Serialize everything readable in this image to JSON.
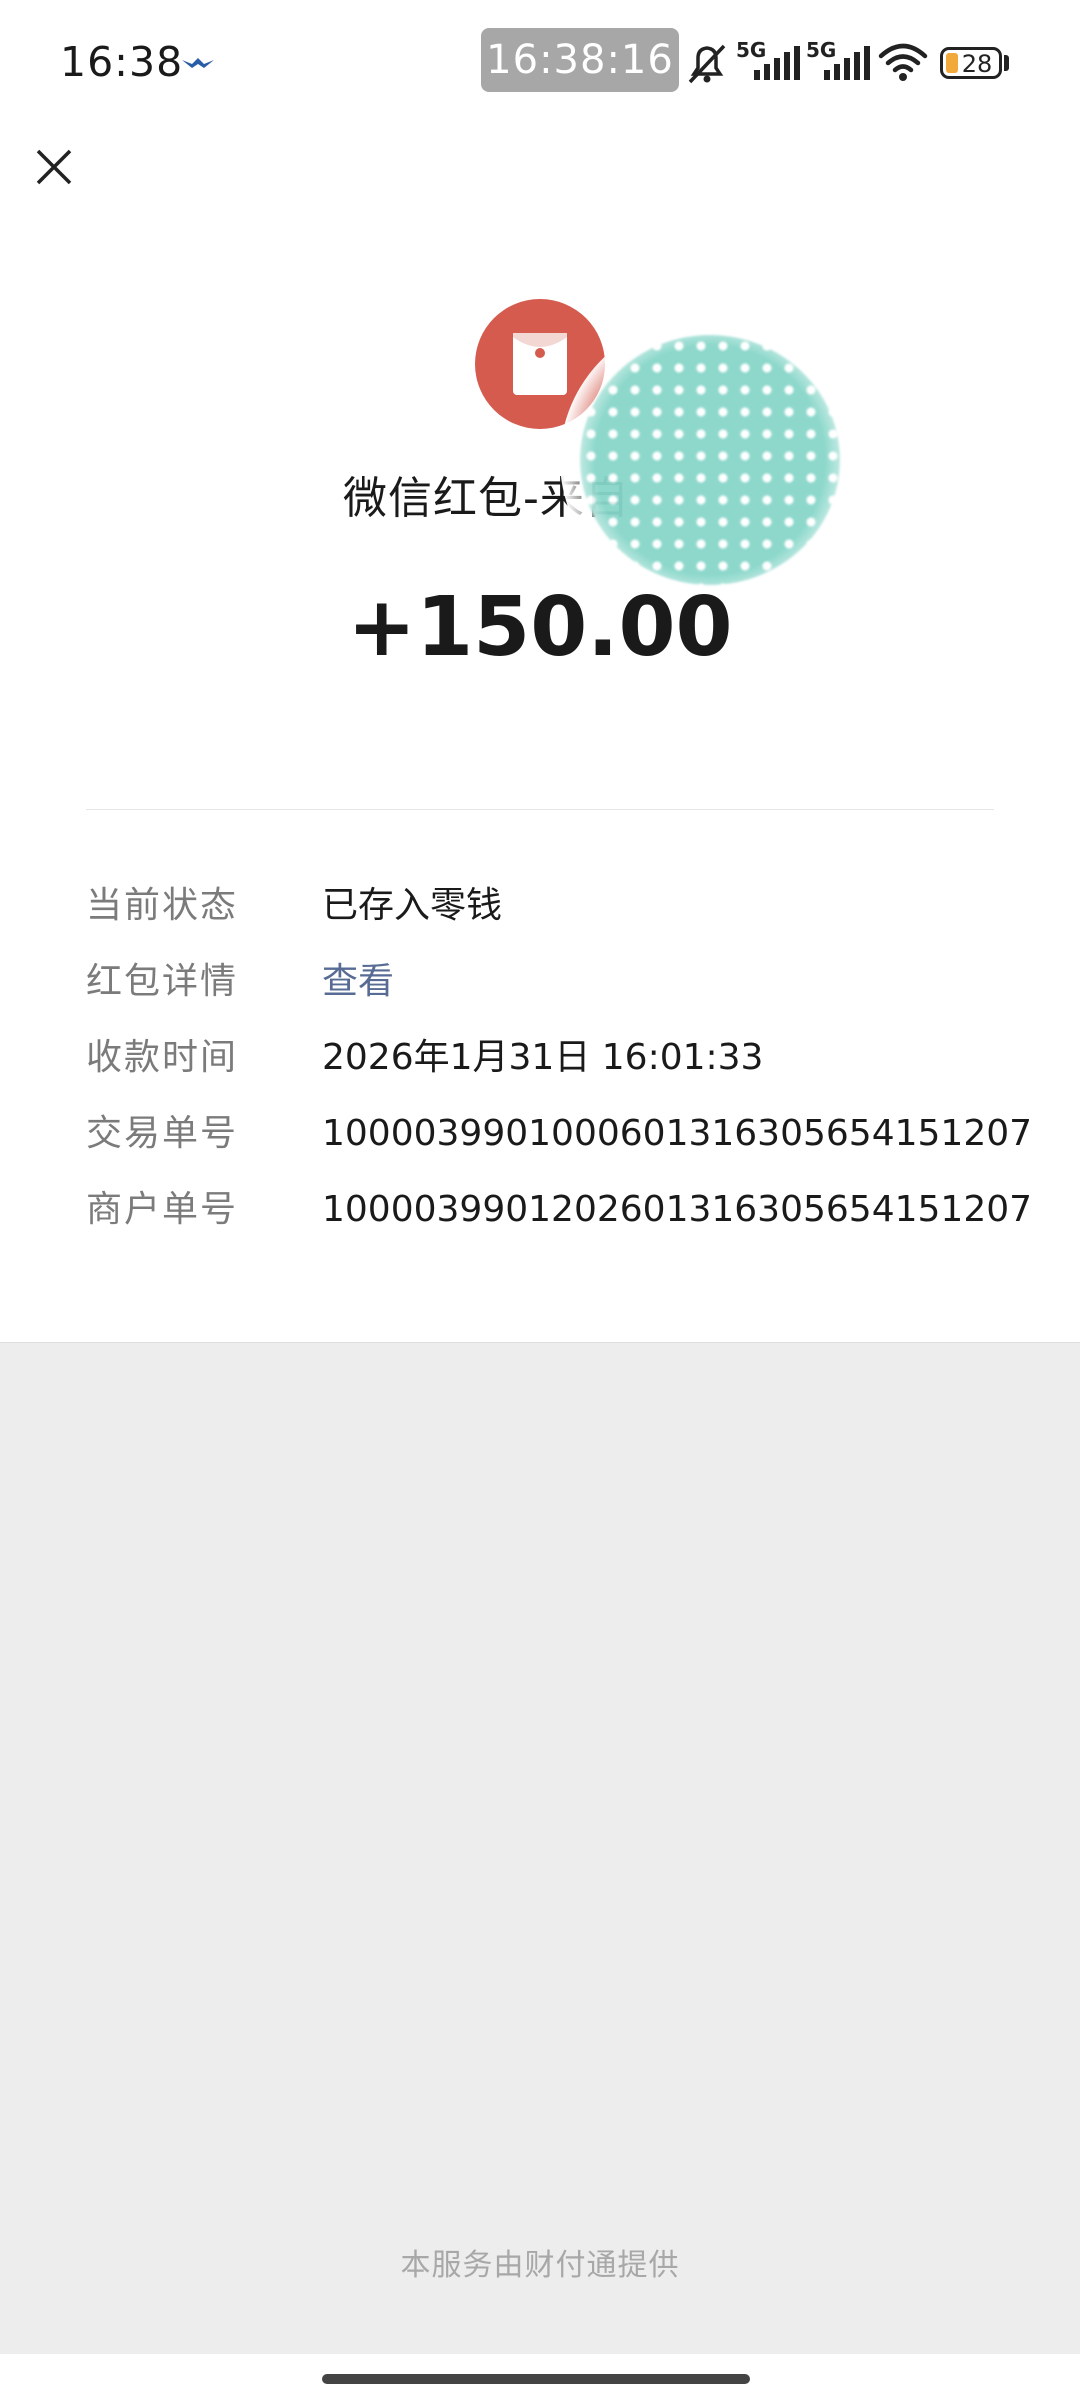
{
  "status_bar": {
    "time": "16:38",
    "overlay_time": "16:38:16",
    "battery_level": "28",
    "network_label_1": "5G",
    "network_label_2": "5G",
    "battery_fill_color": "#f0a93a"
  },
  "header": {
    "close_icon": "close-icon"
  },
  "packet": {
    "icon": "red-envelope-icon",
    "icon_color": "#d55b4e",
    "title": "微信红包-来自",
    "amount": "+150.00"
  },
  "details": [
    {
      "label": "当前状态",
      "value": "已存入零钱"
    },
    {
      "label": "红包详情",
      "value": "查看"
    },
    {
      "label": "收款时间",
      "value": "2026年1月31日 16:01:33"
    },
    {
      "label": "交易单号",
      "value": "1000039901000601316305654151207"
    },
    {
      "label": "商户单号",
      "value": "1000039901202601316305654151207"
    }
  ],
  "footer": {
    "provider_text": "本服务由财付通提供"
  },
  "colors": {
    "link": "#576b95",
    "label": "#7b7b7b",
    "background": "#ededed"
  }
}
